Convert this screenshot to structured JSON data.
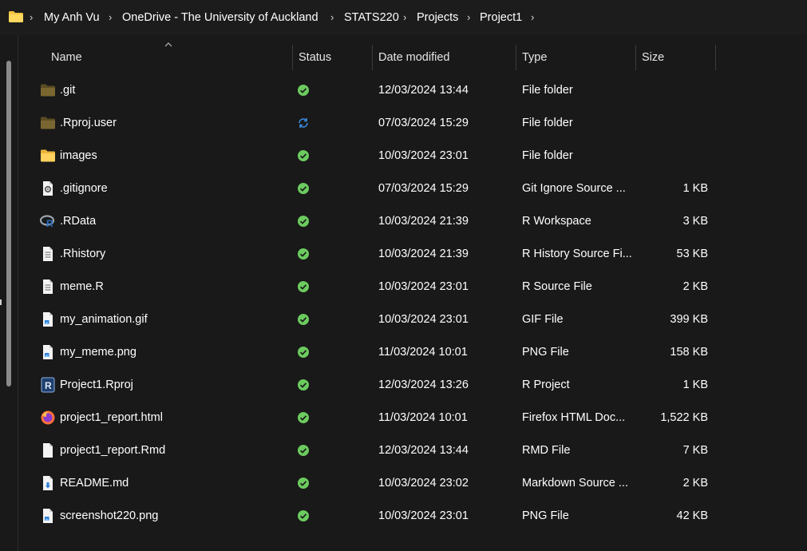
{
  "breadcrumb": {
    "items": [
      "My Anh Vu",
      "OneDrive - The University of Auckland",
      "STATS220",
      "Projects",
      "Project1"
    ],
    "separator": "›"
  },
  "columns": {
    "name": "Name",
    "status": "Status",
    "date_modified": "Date modified",
    "type": "Type",
    "size": "Size"
  },
  "colors": {
    "background": "#191919",
    "status_synced": "#6ccb5f",
    "status_syncing": "#3a8dde",
    "folder_dark": "#6b5a2a",
    "folder_light": "#f5c442"
  },
  "files": [
    {
      "name": ".git",
      "icon": "folder-dark-icon",
      "status": "synced-icon",
      "date": "12/03/2024 13:44",
      "type": "File folder",
      "size": ""
    },
    {
      "name": ".Rproj.user",
      "icon": "folder-dark-icon",
      "status": "syncing-icon",
      "date": "07/03/2024 15:29",
      "type": "File folder",
      "size": ""
    },
    {
      "name": "images",
      "icon": "folder-icon",
      "status": "synced-icon",
      "date": "10/03/2024 23:01",
      "type": "File folder",
      "size": ""
    },
    {
      "name": ".gitignore",
      "icon": "settings-file-icon",
      "status": "synced-icon",
      "date": "07/03/2024 15:29",
      "type": "Git Ignore Source ...",
      "size": "1 KB"
    },
    {
      "name": ".RData",
      "icon": "r-logo-icon",
      "status": "synced-icon",
      "date": "10/03/2024 21:39",
      "type": "R Workspace",
      "size": "3 KB"
    },
    {
      "name": ".Rhistory",
      "icon": "text-file-icon",
      "status": "synced-icon",
      "date": "10/03/2024 21:39",
      "type": "R History Source Fi...",
      "size": "53 KB"
    },
    {
      "name": "meme.R",
      "icon": "text-file-icon",
      "status": "synced-icon",
      "date": "10/03/2024 23:01",
      "type": "R Source File",
      "size": "2 KB"
    },
    {
      "name": "my_animation.gif",
      "icon": "image-file-icon",
      "status": "synced-icon",
      "date": "10/03/2024 23:01",
      "type": "GIF File",
      "size": "399 KB"
    },
    {
      "name": "my_meme.png",
      "icon": "image-file-icon",
      "status": "synced-icon",
      "date": "11/03/2024 10:01",
      "type": "PNG File",
      "size": "158 KB"
    },
    {
      "name": "Project1.Rproj",
      "icon": "r-project-icon",
      "status": "synced-icon",
      "date": "12/03/2024 13:26",
      "type": "R Project",
      "size": "1 KB"
    },
    {
      "name": "project1_report.html",
      "icon": "firefox-icon",
      "status": "synced-icon",
      "date": "11/03/2024 10:01",
      "type": "Firefox HTML Doc...",
      "size": "1,522 KB"
    },
    {
      "name": "project1_report.Rmd",
      "icon": "blank-file-icon",
      "status": "synced-icon",
      "date": "12/03/2024 13:44",
      "type": "RMD File",
      "size": "7 KB"
    },
    {
      "name": "README.md",
      "icon": "markdown-file-icon",
      "status": "synced-icon",
      "date": "10/03/2024 23:02",
      "type": "Markdown Source ...",
      "size": "2 KB"
    },
    {
      "name": "screenshot220.png",
      "icon": "image-file-icon",
      "status": "synced-icon",
      "date": "10/03/2024 23:01",
      "type": "PNG File",
      "size": "42 KB"
    }
  ]
}
